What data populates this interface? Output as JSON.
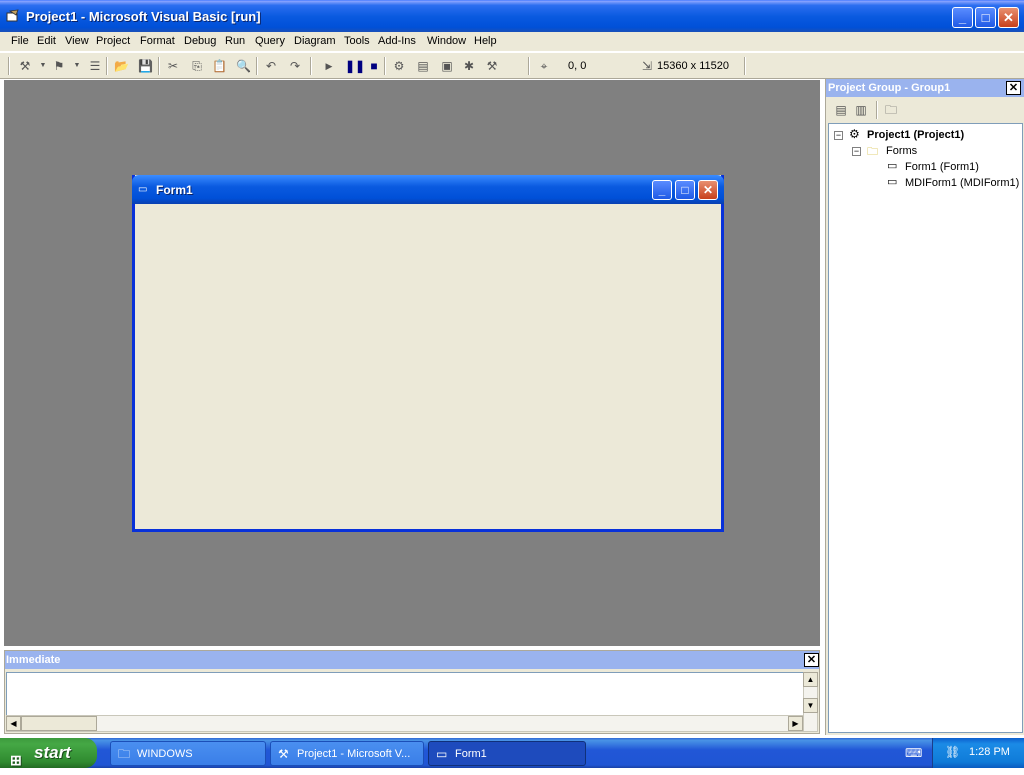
{
  "window": {
    "title": "Project1 - Microsoft Visual Basic [run]",
    "min": "_",
    "max": "□",
    "close": "✕"
  },
  "menu": [
    "File",
    "Edit",
    "View",
    "Project",
    "Format",
    "Debug",
    "Run",
    "Query",
    "Diagram",
    "Tools",
    "Add-Ins",
    "Window",
    "Help"
  ],
  "toolbar": {
    "position": "0, 0",
    "size": "15360 x 11520"
  },
  "form": {
    "title": "Form1"
  },
  "immediate": {
    "title": "Immediate",
    "close": "✕"
  },
  "project_group": {
    "title": "Project Group - Group1",
    "close": "✕",
    "tree": {
      "project": "Project1 (Project1)",
      "folder": "Forms",
      "items": [
        "Form1 (Form1)",
        "MDIForm1 (MDIForm1)"
      ]
    }
  },
  "taskbar": {
    "start": "start",
    "tasks": [
      "WINDOWS",
      "Project1 - Microsoft V...",
      "Form1"
    ],
    "clock": "1:28 PM"
  },
  "colors": {
    "xp_blue": "#0050d8",
    "mdi_gray": "#808080",
    "face": "#ece9d8"
  }
}
